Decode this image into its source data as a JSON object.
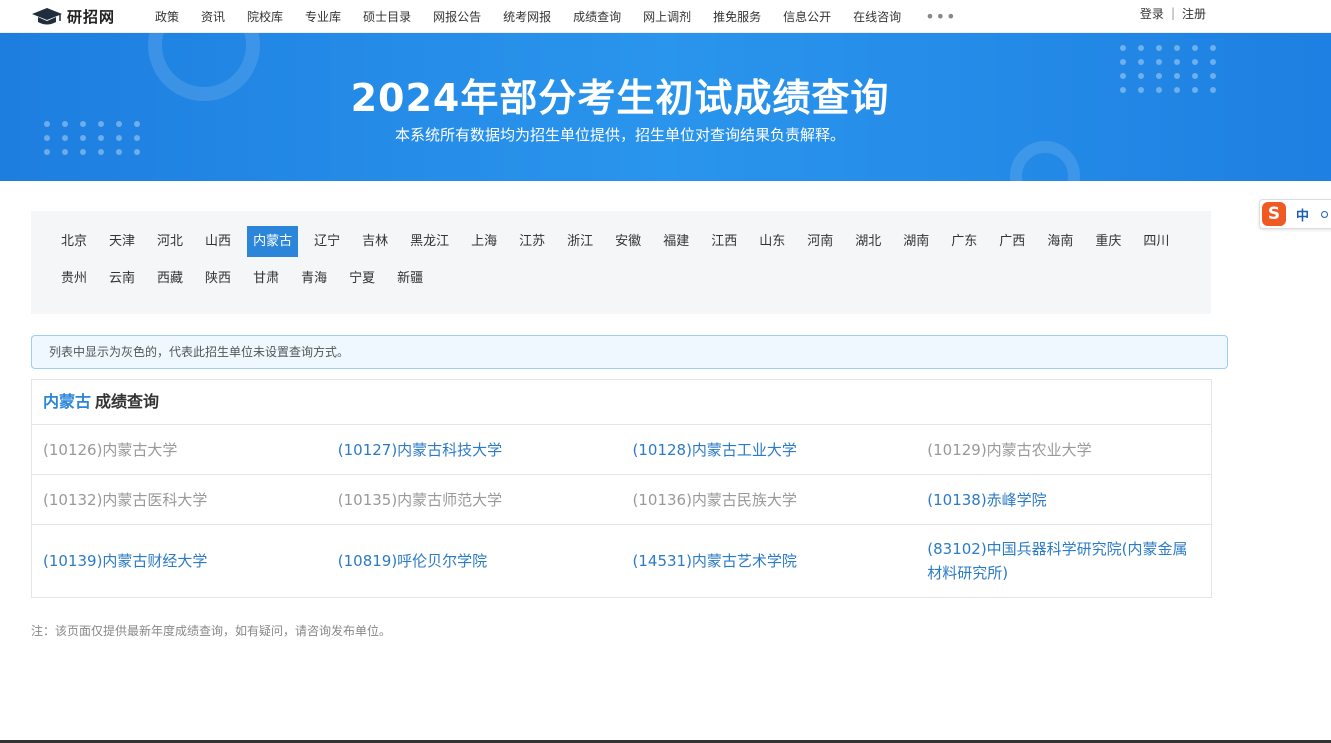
{
  "site": {
    "logo_text": "研招网"
  },
  "nav": {
    "items": [
      "政策",
      "资讯",
      "院校库",
      "专业库",
      "硕士目录",
      "网报公告",
      "统考网报",
      "成绩查询",
      "网上调剂",
      "推免服务",
      "信息公开",
      "在线咨询"
    ],
    "more": "•••"
  },
  "auth": {
    "login": "登录",
    "separator": "|",
    "register": "注册"
  },
  "banner": {
    "title": "2024年部分考生初试成绩查询",
    "subtitle": "本系统所有数据均为招生单位提供，招生单位对查询结果负责解释。"
  },
  "ime": {
    "logo": "S",
    "label": "中",
    "dot": "°"
  },
  "provinces": {
    "row1": [
      "北京",
      "天津",
      "河北",
      "山西",
      "内蒙古",
      "辽宁",
      "吉林",
      "黑龙江",
      "上海",
      "江苏",
      "浙江",
      "安徽",
      "福建",
      "江西",
      "山东",
      "河南",
      "湖北",
      "湖南",
      "广东",
      "广西",
      "海南",
      "重庆",
      "四川"
    ],
    "row2": [
      "贵州",
      "云南",
      "西藏",
      "陕西",
      "甘肃",
      "青海",
      "宁夏",
      "新疆"
    ],
    "active": "内蒙古"
  },
  "notice": "列表中显示为灰色的，代表此招生单位未设置查询方式。",
  "results": {
    "province": "内蒙古",
    "heading": "成绩查询",
    "rows": [
      [
        {
          "text": "(10126)内蒙古大学",
          "active": false
        },
        {
          "text": "(10127)内蒙古科技大学",
          "active": true
        },
        {
          "text": "(10128)内蒙古工业大学",
          "active": true
        },
        {
          "text": "(10129)内蒙古农业大学",
          "active": false
        }
      ],
      [
        {
          "text": "(10132)内蒙古医科大学",
          "active": false
        },
        {
          "text": "(10135)内蒙古师范大学",
          "active": false
        },
        {
          "text": "(10136)内蒙古民族大学",
          "active": false
        },
        {
          "text": "(10138)赤峰学院",
          "active": true
        }
      ],
      [
        {
          "text": "(10139)内蒙古财经大学",
          "active": true
        },
        {
          "text": "(10819)呼伦贝尔学院",
          "active": true
        },
        {
          "text": "(14531)内蒙古艺术学院",
          "active": true
        },
        {
          "text": "(83102)中国兵器科学研究院(内蒙金属材料研究所)",
          "active": true
        }
      ]
    ]
  },
  "footnote": "注：该页面仅提供最新年度成绩查询，如有疑问，请咨询发布单位。",
  "colors": {
    "accent": "#2b86d9",
    "banner": "#1e86e6",
    "disabled": "#999999",
    "link": "#2b7bc7"
  }
}
